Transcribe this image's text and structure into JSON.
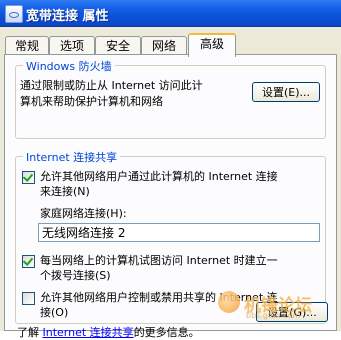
{
  "window": {
    "title": "宽带连接 属性"
  },
  "tabs": [
    {
      "label": "常规",
      "active": false
    },
    {
      "label": "选项",
      "active": false
    },
    {
      "label": "安全",
      "active": false
    },
    {
      "label": "网络",
      "active": false
    },
    {
      "label": "高级",
      "active": true
    }
  ],
  "firewall": {
    "group_title": "Windows 防火墙",
    "description_line1": "通过限制或防止从 Internet 访问此计",
    "description_line2": "算机来帮助保护计算机和网络",
    "settings_button": "设置(E)..."
  },
  "ics": {
    "group_title": "Internet 连接共享",
    "allow_share": {
      "checked": true,
      "line1": "允许其他网络用户通过此计算机的 Internet 连接",
      "line2": "来连接(N)"
    },
    "home_network_label": "家庭网络连接(H):",
    "home_network_value": "无线网络连接 2",
    "dial_on_demand": {
      "checked": true,
      "line1": "每当网络上的计算机试图访问 Internet 时建立一",
      "line2": "个拨号连接(S)"
    },
    "allow_control": {
      "checked": false,
      "line1": "允许其他网络用户控制或禁用共享的 Internet 连",
      "line2": "接(O)"
    }
  },
  "footer": {
    "prefix": "了解 ",
    "link": "Internet 连接共享",
    "suffix": "的更多信息。",
    "settings_button": "设置(G)..."
  },
  "watermark": {
    "text": "机锋论坛",
    "url": "bbs.gfan.com"
  },
  "colors": {
    "titlebar": "#0a4fd6",
    "group_title": "#0046d5",
    "dialog_bg": "#ece9d8",
    "panel_bg": "#fcfcfe"
  }
}
